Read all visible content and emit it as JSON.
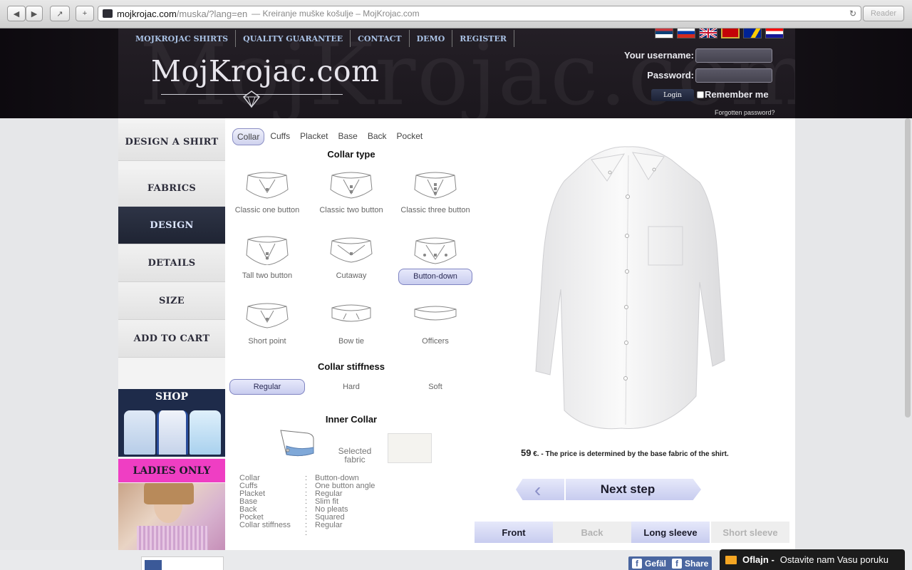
{
  "browser": {
    "url_host": "mojkrojac.com",
    "url_path": "/muska/?lang=en",
    "page_title": "— Kreiranje muške košulje – MojKrojac.com",
    "reader_label": "Reader"
  },
  "header": {
    "nav": [
      "MOJKROJAC SHIRTS",
      "QUALITY GUARANTEE",
      "CONTACT",
      "DEMO",
      "REGISTER"
    ],
    "logo": "MojKrojac.com",
    "watermark": "MojKrojac.com",
    "username_label": "Your username:",
    "password_label": "Password:",
    "login_button": "Login",
    "remember_label": "Remember me",
    "forgot_link": "Forgotten password?",
    "flags": [
      "serbia-flag",
      "russia-flag",
      "uk-flag",
      "montenegro-flag",
      "bosnia-flag",
      "croatia-flag"
    ]
  },
  "steps": [
    "DESIGN A SHIRT",
    "FABRICS",
    "DESIGN",
    "DETAILS",
    "SIZE",
    "ADD TO CART"
  ],
  "active_step": "DESIGN",
  "banners": {
    "shop": "SHOP",
    "ladies": "LADIES ONLY"
  },
  "tabs": [
    "Collar",
    "Cuffs",
    "Placket",
    "Base",
    "Back",
    "Pocket"
  ],
  "active_tab": "Collar",
  "collar_type_title": "Collar type",
  "collars": [
    "Classic one button",
    "Classic two button",
    "Classic three button",
    "Tall two button",
    "Cutaway",
    "Button-down",
    "Short point",
    "Bow tie",
    "Officers"
  ],
  "selected_collar": "Button-down",
  "stiffness_title": "Collar stiffness",
  "stiffness": [
    "Regular",
    "Hard",
    "Soft"
  ],
  "selected_stiffness": "Regular",
  "inner_collar_title": "Inner Collar",
  "selected_fabric_label": "Selected fabric",
  "summary": [
    {
      "key": "Collar",
      "value": "Button-down"
    },
    {
      "key": "Cuffs",
      "value": "One button angle"
    },
    {
      "key": "Placket",
      "value": "Regular"
    },
    {
      "key": "Base",
      "value": "Slim fit"
    },
    {
      "key": "Back",
      "value": "No pleats"
    },
    {
      "key": "Pocket",
      "value": "Squared"
    },
    {
      "key": "Collar stiffness",
      "value": "Regular"
    }
  ],
  "price": {
    "amount": "59",
    "currency_note": "€. - The price is determined by the base fabric of the shirt."
  },
  "next_step": "Next step",
  "views": [
    "Front",
    "Back",
    "Long sleeve",
    "Short sleeve"
  ],
  "views_on": [
    "Front",
    "Long sleeve"
  ],
  "footer": {
    "like": "Gefäl",
    "share": "Share",
    "chat_status": "Oflajn -",
    "chat_text": "Ostavite nam Vasu poruku"
  },
  "colors": {
    "accent": "#c8ccef",
    "header_bg": "#1b171d",
    "nav_text": "#a9c1e4",
    "ladies": "#ef3ec3"
  }
}
